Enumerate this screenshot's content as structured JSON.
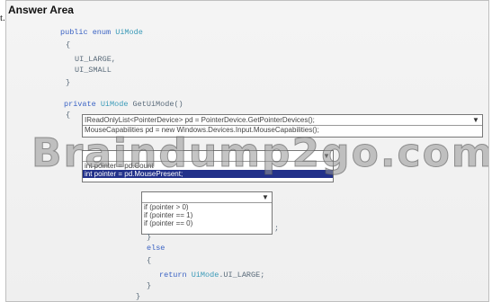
{
  "stray_char": "t.",
  "title": "Answer Area",
  "code": {
    "line1_kw": "public enum",
    "line1_type": "UiMode",
    "brace_open": "{",
    "line3": "UI_LARGE,",
    "line4": "UI_SMALL",
    "brace_close": "}",
    "private_kw": "private",
    "private_type": "UiMode",
    "private_name": "GetUiMode()",
    "brace_open2": "{",
    "line_semicolon": ";",
    "brace_close_inner": "}",
    "else_kw": "else",
    "brace_open3": "{",
    "return_kw": "return",
    "return_type": "UiMode",
    "return_val": ".UI_LARGE;",
    "brace_close3": "}",
    "brace_close_final": "}"
  },
  "dropdown1": {
    "options": [
      "IReadOnlyList<PointerDevice> pd = PointerDevice.GetPointerDevices();",
      "MouseCapabilities pd = new Windows.Devices.Input.MouseCapabilities();"
    ]
  },
  "dropdown2": {
    "options": [
      "int pointer = pd.Count",
      "int pointer = pd.MousePresent;"
    ],
    "selected_index": 1
  },
  "dropdown3": {
    "options": [
      "if (pointer > 0)",
      "if (pointer == 1)",
      "if (pointer == 0)"
    ]
  },
  "watermark": "Braindump2go.com"
}
